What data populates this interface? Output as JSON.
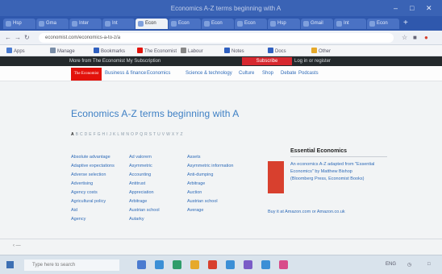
{
  "colors": {
    "chrome": "#3a63b5",
    "brand_red": "#e3120b",
    "link_blue": "#2f6bb8",
    "heading_blue": "#3d7fc4"
  },
  "browser": {
    "window_title": "Economics A-Z terms beginning with A",
    "min_icon": "minimize-icon",
    "max_icon": "maximize-icon",
    "close_icon": "close-icon",
    "tabs": [
      {
        "label": "Hsp"
      },
      {
        "label": "Gma"
      },
      {
        "label": "Inter"
      },
      {
        "label": "Int"
      },
      {
        "label": "Econ"
      },
      {
        "label": "Econ"
      },
      {
        "label": "Econ"
      },
      {
        "label": "Econ"
      },
      {
        "label": "Hsp"
      },
      {
        "label": "Gmail"
      },
      {
        "label": "Int"
      },
      {
        "label": "Econ"
      }
    ],
    "new_tab": "+",
    "address": "economist.com/economics-a-to-z/a",
    "bookmarks": [
      {
        "label": "Apps",
        "color": "#4a7bd0"
      },
      {
        "label": "Manage",
        "color": "#7a8ea8"
      },
      {
        "label": "Bookmarks",
        "color": "#3060c0"
      },
      {
        "label": "The Economist",
        "color": "#e3120b"
      },
      {
        "label": "Labour",
        "color": "#888"
      },
      {
        "label": "Notes",
        "color": "#3060c0"
      },
      {
        "label": "Docs",
        "color": "#3060c0"
      },
      {
        "label": "Other",
        "color": "#e6a92a"
      }
    ]
  },
  "site": {
    "topbar_text": "More from The Economist   My Subscription",
    "subscribe": "Subscribe",
    "login": "Log in or register",
    "logo": "The Economist",
    "nav": [
      "Business & finance",
      "Economics",
      "Science & technology",
      "Culture",
      "Shop",
      "Debate",
      "Podcasts"
    ],
    "heading": "Economics A-Z terms beginning with A",
    "alphabet": [
      "A",
      "B",
      "C",
      "D",
      "E",
      "F",
      "G",
      "H",
      "I",
      "J",
      "K",
      "L",
      "M",
      "N",
      "O",
      "P",
      "Q",
      "R",
      "S",
      "T",
      "U",
      "V",
      "W",
      "X",
      "Y",
      "Z"
    ],
    "columns": [
      [
        "Absolute advantage",
        "Adaptive expectations",
        "Adverse selection",
        "Advertising",
        "Agency costs",
        "Agricultural policy",
        "Aid",
        "Agency"
      ],
      [
        "Ad valorem",
        "Asymmetric",
        "Accounting",
        "Antitrust",
        "Appreciation",
        "Arbitrage",
        "Austrian school",
        "Autarky"
      ],
      [
        "Assets",
        "Asymmetric information",
        "Anti-dumping",
        "Arbitrage",
        "Auction",
        "Austrian school",
        "Average"
      ]
    ],
    "sidebar": {
      "heading": "Essential Economics",
      "book_text": "An economics A-Z adapted from \"Essential Economics\" by Matthew Bishop (Bloomberg Press, Economist Books)",
      "buy": "Buy it at Amazon.com or Amazon.co.uk"
    }
  },
  "taskbar": {
    "search_placeholder": "Type here to search",
    "apps": [
      "#4a7bd0",
      "#3b8fd6",
      "#2f9d6b",
      "#e6a92a",
      "#d8402e",
      "#3b8fd6",
      "#7a5cc7",
      "#3b8fd6",
      "#d84b8a"
    ],
    "tray": "ENG"
  }
}
